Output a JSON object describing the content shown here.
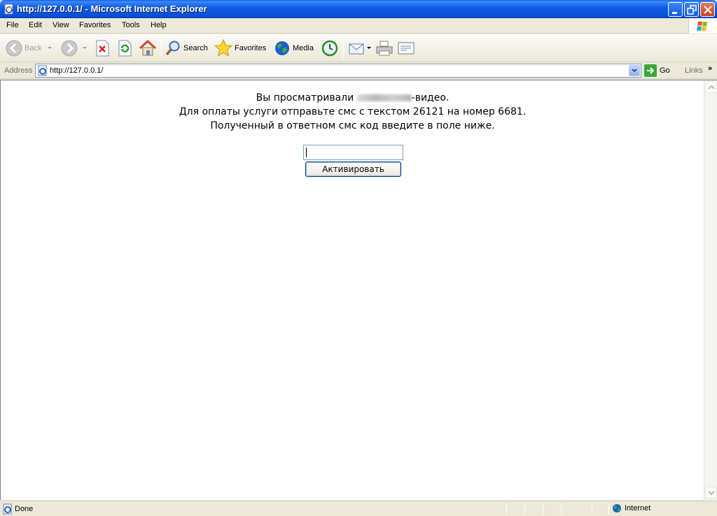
{
  "window": {
    "title": "http://127.0.0.1/ - Microsoft Internet Explorer"
  },
  "menu": [
    "File",
    "Edit",
    "View",
    "Favorites",
    "Tools",
    "Help"
  ],
  "toolbar": {
    "back": "Back",
    "search": "Search",
    "favorites": "Favorites",
    "media": "Media"
  },
  "address": {
    "label": "Address",
    "url": "http://127.0.0.1/",
    "go": "Go",
    "links": "Links"
  },
  "page": {
    "line1_prefix": "Вы просматривали ",
    "line1_suffix": "-видео.",
    "line2": "Для оплаты услуги отправьте смс с текстом 26121 на номер 6681.",
    "line3": "Полученный в ответном смс код введите в поле ниже.",
    "code_value": "",
    "activate_label": "Активировать"
  },
  "status": {
    "text": "Done",
    "zone": "Internet"
  },
  "colors": {
    "titlebar": "#0a50d6",
    "chrome": "#ece9d8",
    "input_border": "#7f9db9"
  }
}
